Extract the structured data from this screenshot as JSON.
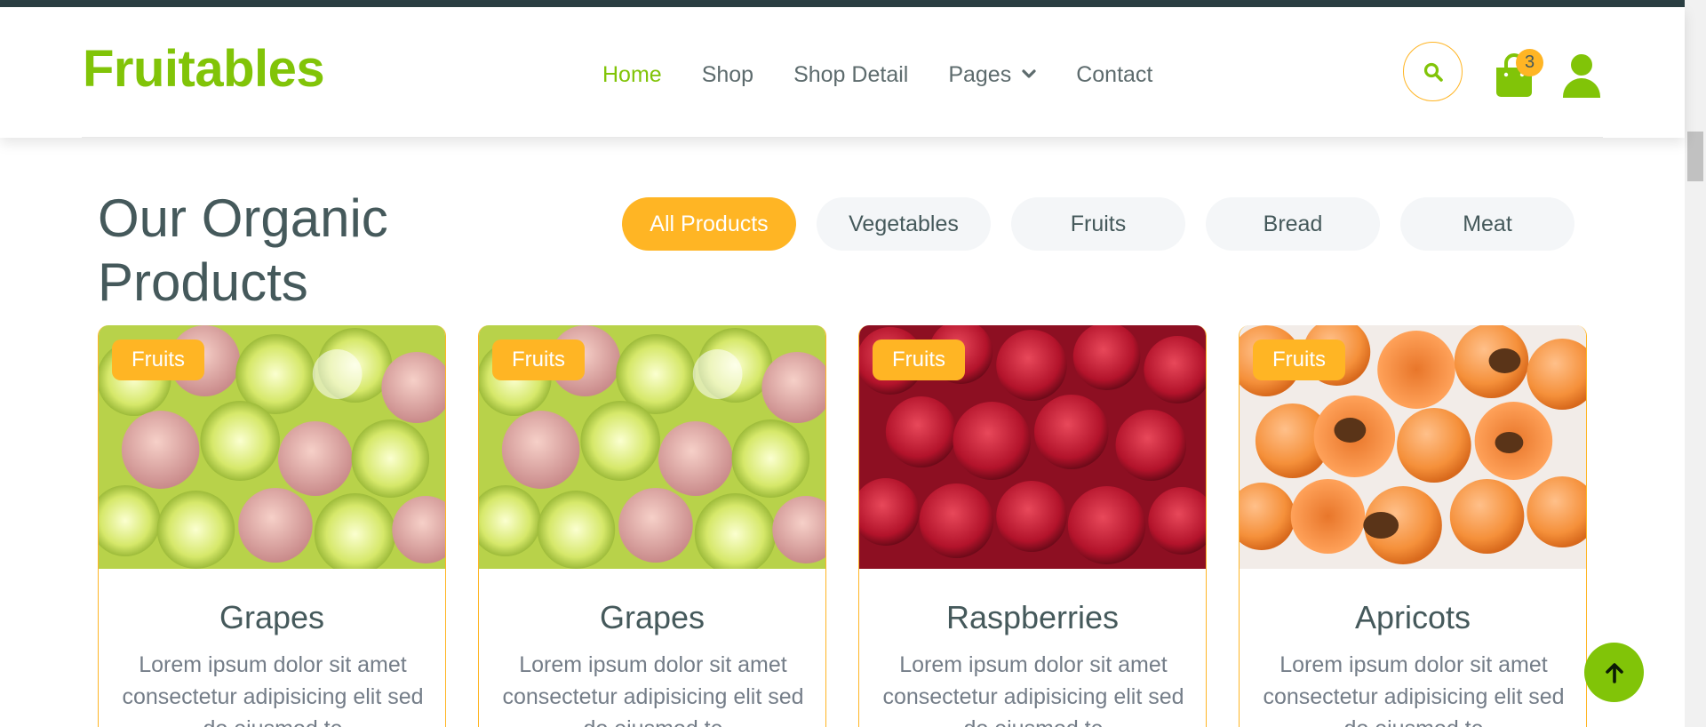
{
  "brand": {
    "logo_text": "Fruitables",
    "primary_color": "#81c408",
    "accent_color": "#ffb524",
    "text_color": "#45595b"
  },
  "nav": {
    "links": [
      {
        "label": "Home",
        "active": true
      },
      {
        "label": "Shop"
      },
      {
        "label": "Shop Detail"
      },
      {
        "label": "Pages",
        "has_dropdown": true
      },
      {
        "label": "Contact"
      }
    ],
    "cart_count": "3",
    "icons": [
      "search-icon",
      "shopping-bag-icon",
      "user-icon"
    ]
  },
  "section": {
    "title": "Our Organic Products",
    "tabs": [
      {
        "label": "All Products",
        "active": true
      },
      {
        "label": "Vegetables"
      },
      {
        "label": "Fruits"
      },
      {
        "label": "Bread"
      },
      {
        "label": "Meat"
      }
    ]
  },
  "products": [
    {
      "badge": "Fruits",
      "name": "Grapes",
      "description": "Lorem ipsum dolor sit amet consectetur adipisicing elit sed do eiusmod te"
    },
    {
      "badge": "Fruits",
      "name": "Grapes",
      "description": "Lorem ipsum dolor sit amet consectetur adipisicing elit sed do eiusmod te"
    },
    {
      "badge": "Fruits",
      "name": "Raspberries",
      "description": "Lorem ipsum dolor sit amet consectetur adipisicing elit sed do eiusmod te"
    },
    {
      "badge": "Fruits",
      "name": "Apricots",
      "description": "Lorem ipsum dolor sit amet consectetur adipisicing elit sed do eiusmod te"
    }
  ],
  "back_to_top": {
    "icon": "arrow-up-icon"
  }
}
